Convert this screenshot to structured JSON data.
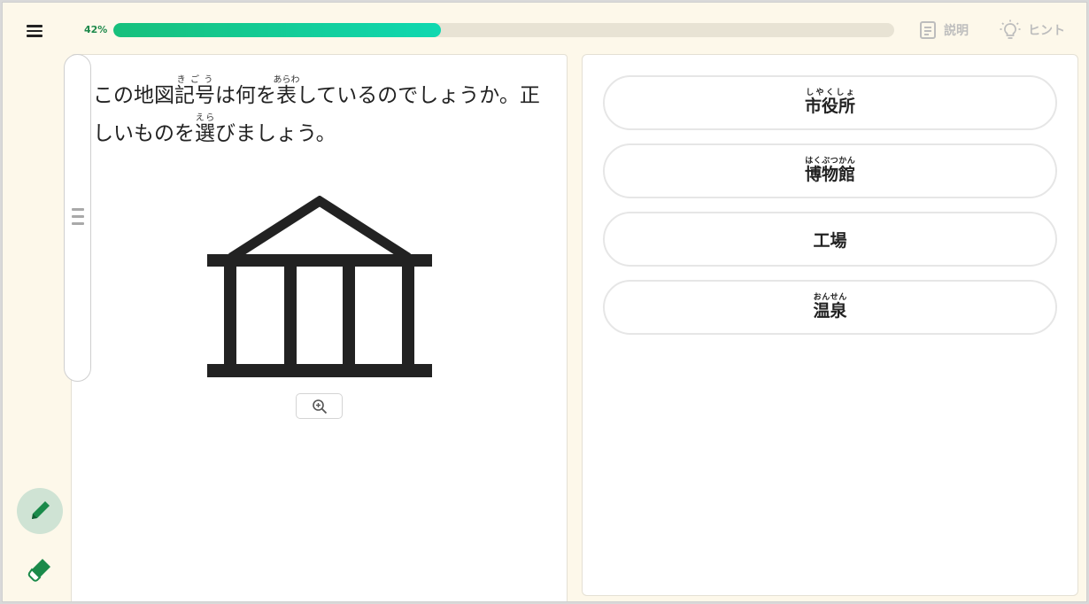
{
  "header": {
    "menu_icon": "hamburger-menu-icon",
    "progress": {
      "label": "42%",
      "value": 0.42
    },
    "explain_label": "説明",
    "explain_icon": "document-icon",
    "hint_label": "ヒント",
    "hint_icon": "lightbulb-icon"
  },
  "question": {
    "segments": [
      {
        "text": "この地図"
      },
      {
        "base": "記号",
        "ruby": "きごう"
      },
      {
        "text": "は何を"
      },
      {
        "base": "表",
        "ruby": "あらわ"
      },
      {
        "text": "しているのでしょうか。正しいものを"
      },
      {
        "base": "選",
        "ruby": "えら"
      },
      {
        "text": "びましょう。"
      }
    ],
    "image_icon": "museum-map-symbol",
    "zoom_icon": "zoom-in-icon"
  },
  "options": [
    {
      "base": "市役所",
      "ruby": "しやくしょ"
    },
    {
      "base": "博物館",
      "ruby": "はくぶつかん"
    },
    {
      "base": "工場",
      "ruby": ""
    },
    {
      "base": "温泉",
      "ruby": "おんせん"
    }
  ],
  "tools": [
    {
      "icon": "pencil-icon",
      "active": true
    },
    {
      "icon": "eraser-icon",
      "active": false
    }
  ],
  "colors": {
    "accent": "#1f8a4c",
    "progress_start": "#17c07c",
    "progress_end": "#10d8b0",
    "background": "#fdf8ea"
  }
}
